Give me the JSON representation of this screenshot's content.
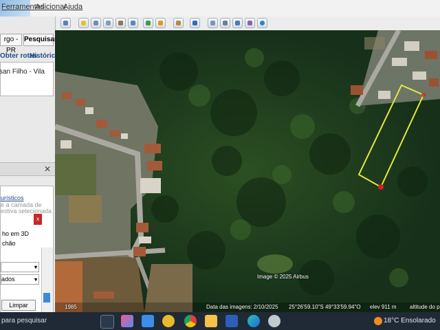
{
  "menu": {
    "items": [
      "Ferramentas",
      "Adicionar",
      "Ajuda"
    ]
  },
  "sidebar": {
    "tab_left": "rgo - PR",
    "search_button": "Pesquisar",
    "link_routes": "Obter rotas",
    "link_history": "Histórico",
    "result_text": "san Filho - Vila",
    "layers": {
      "item_tourism": "urísticos",
      "hint1": "e a camada de",
      "hint2": "estiva selecionada",
      "item_3d": "ho em 3D",
      "item_ground": "chão",
      "dropdown2": "ados",
      "clear_button": "Limpar"
    }
  },
  "map": {
    "image_credit": "Image © 2025 Airbus",
    "status_date": "Data das imagens: 2/10/2025",
    "coords": "25°26'59.10\"S   49°33'59.94\"O",
    "elev": "elev   911 m",
    "eye_alt": "altitude do p",
    "year": "1985"
  },
  "taskbar": {
    "search_placeholder": "para pesquisar",
    "weather": "18°C  Ensolarado"
  },
  "colors": {
    "plot_outline": "#e8e83a",
    "marker": "#d42020",
    "link": "#1e4b8a"
  }
}
